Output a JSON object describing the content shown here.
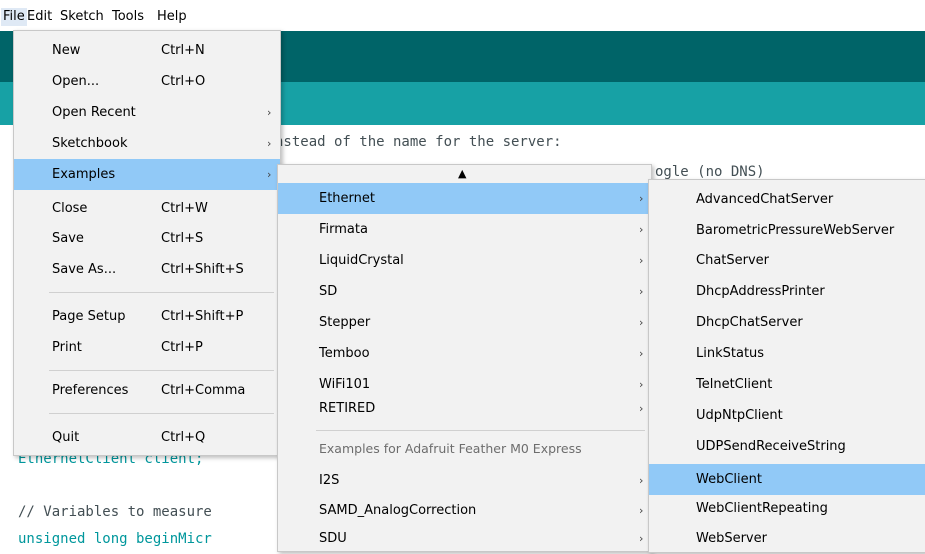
{
  "menubar": {
    "items": [
      "File",
      "Edit",
      "Sketch",
      "Tools",
      "Help"
    ]
  },
  "editor": {
    "lines": [
      "nstead of the name for the server:",
      "ogle (no DNS)",
      "EthernetClient client;",
      "// Variables to measure",
      "unsigned long beginMicr"
    ]
  },
  "file_menu": {
    "items": [
      {
        "label": "New",
        "shortcut": "Ctrl+N"
      },
      {
        "label": "Open...",
        "shortcut": "Ctrl+O"
      },
      {
        "label": "Open Recent",
        "shortcut": "",
        "arrow": "›"
      },
      {
        "label": "Sketchbook",
        "shortcut": "",
        "arrow": "›"
      },
      {
        "label": "Examples",
        "shortcut": "",
        "arrow": "›"
      },
      {
        "label": "Close",
        "shortcut": "Ctrl+W"
      },
      {
        "label": "Save",
        "shortcut": "Ctrl+S"
      },
      {
        "label": "Save As...",
        "shortcut": "Ctrl+Shift+S"
      },
      {
        "label": "Page Setup",
        "shortcut": "Ctrl+Shift+P"
      },
      {
        "label": "Print",
        "shortcut": "Ctrl+P"
      },
      {
        "label": "Preferences",
        "shortcut": "Ctrl+Comma"
      },
      {
        "label": "Quit",
        "shortcut": "Ctrl+Q"
      }
    ]
  },
  "examples_menu": {
    "scroll_up": "▲",
    "items": [
      {
        "label": "Ethernet"
      },
      {
        "label": "Firmata"
      },
      {
        "label": "LiquidCrystal"
      },
      {
        "label": "SD"
      },
      {
        "label": "Stepper"
      },
      {
        "label": "Temboo"
      },
      {
        "label": "WiFi101"
      },
      {
        "label": "RETIRED"
      }
    ],
    "section_header": "Examples for Adafruit Feather M0 Express",
    "board_items": [
      {
        "label": "I2S"
      },
      {
        "label": "SAMD_AnalogCorrection"
      },
      {
        "label": "SDU"
      }
    ]
  },
  "ethernet_menu": {
    "items": [
      "AdvancedChatServer",
      "BarometricPressureWebServer",
      "ChatServer",
      "DhcpAddressPrinter",
      "DhcpChatServer",
      "LinkStatus",
      "TelnetClient",
      "UdpNtpClient",
      "UDPSendReceiveString",
      "WebClient",
      "WebClientRepeating",
      "WebServer"
    ]
  },
  "colors": {
    "toolbar_dark": "#006468",
    "toolbar_teal": "#17a1a5",
    "highlight": "#91c9f7",
    "menu_bg": "#f2f2f2"
  }
}
